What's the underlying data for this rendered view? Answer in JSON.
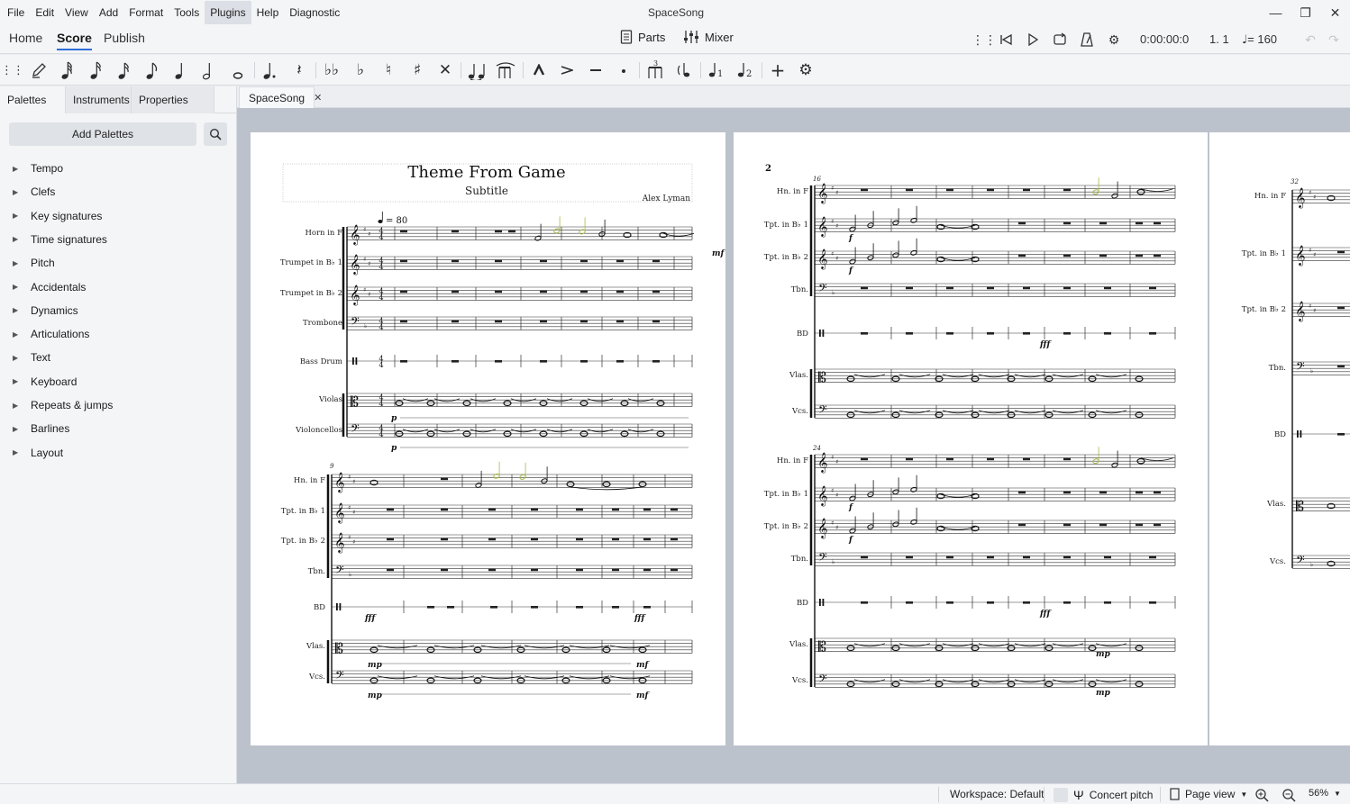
{
  "menubar": {
    "items": [
      "File",
      "Edit",
      "View",
      "Add",
      "Format",
      "Tools",
      "Plugins",
      "Help",
      "Diagnostic"
    ],
    "active": "Plugins",
    "window_title": "SpaceSong"
  },
  "workspace_tabs": [
    "Home",
    "Score",
    "Publish"
  ],
  "active_workspace_tab": "Score",
  "topbar": {
    "parts_label": "Parts",
    "mixer_label": "Mixer",
    "time": "0:00:00:0",
    "position": "1. 1",
    "tempo_value": "= 160"
  },
  "note_toolbar": {
    "tool_icons": [
      "grip-icon",
      "note-input-pen-icon",
      "64th-note-icon",
      "32nd-note-icon",
      "16th-note-icon",
      "eighth-note-icon",
      "quarter-note-icon",
      "half-note-icon",
      "whole-note-icon",
      "augmentation-dot-icon",
      "rest-icon",
      "double-flat-icon",
      "flat-icon",
      "natural-icon",
      "sharp-icon",
      "double-sharp-icon",
      "tie-icon",
      "slur-icon",
      "marcato-icon",
      "accent-icon",
      "tenuto-icon",
      "staccato-icon",
      "tuplet-icon",
      "flip-direction-icon",
      "voice-1-icon",
      "voice-2-icon",
      "add-icon",
      "customize-toolbar-icon"
    ]
  },
  "panel": {
    "tabs": [
      "Palettes",
      "Instruments",
      "Properties"
    ],
    "active_tab": "Palettes",
    "add_palettes_label": "Add Palettes",
    "palettes": [
      "Tempo",
      "Clefs",
      "Key signatures",
      "Time signatures",
      "Pitch",
      "Accidentals",
      "Dynamics",
      "Articulations",
      "Text",
      "Keyboard",
      "Repeats & jumps",
      "Barlines",
      "Layout"
    ]
  },
  "document_tab": {
    "label": "SpaceSong"
  },
  "score": {
    "title": "Theme From Game",
    "subtitle": "Subtitle",
    "composer": "Alex Lyman",
    "tempo_marking": "= 80",
    "page2_number": "2",
    "system1_instruments": [
      "Horn in F",
      "Trumpet in B♭ 1",
      "Trumpet in B♭ 2",
      "Trombone",
      "Bass Drum",
      "Violas",
      "Violoncellos"
    ],
    "short_instruments": [
      "Hn. in F",
      "Tpt. in B♭ 1",
      "Tpt. in B♭ 2",
      "Tbn.",
      "BD",
      "Vlas.",
      "Vcs."
    ],
    "measure_numbers": [
      "9",
      "16",
      "24",
      "32"
    ],
    "dynamics": {
      "p": "p",
      "mf": "mf",
      "mp": "mp",
      "f": "f",
      "fff": "fff"
    }
  },
  "statusbar": {
    "workspace": "Workspace: Default",
    "concert_pitch": "Concert pitch",
    "view_mode": "Page view",
    "zoom": "56%"
  },
  "colors": {
    "accent": "#2f6fd6",
    "canvas": "#bcc2cc",
    "chrome": "#f4f5f7",
    "highlighted_notes": "#a6b84a"
  }
}
